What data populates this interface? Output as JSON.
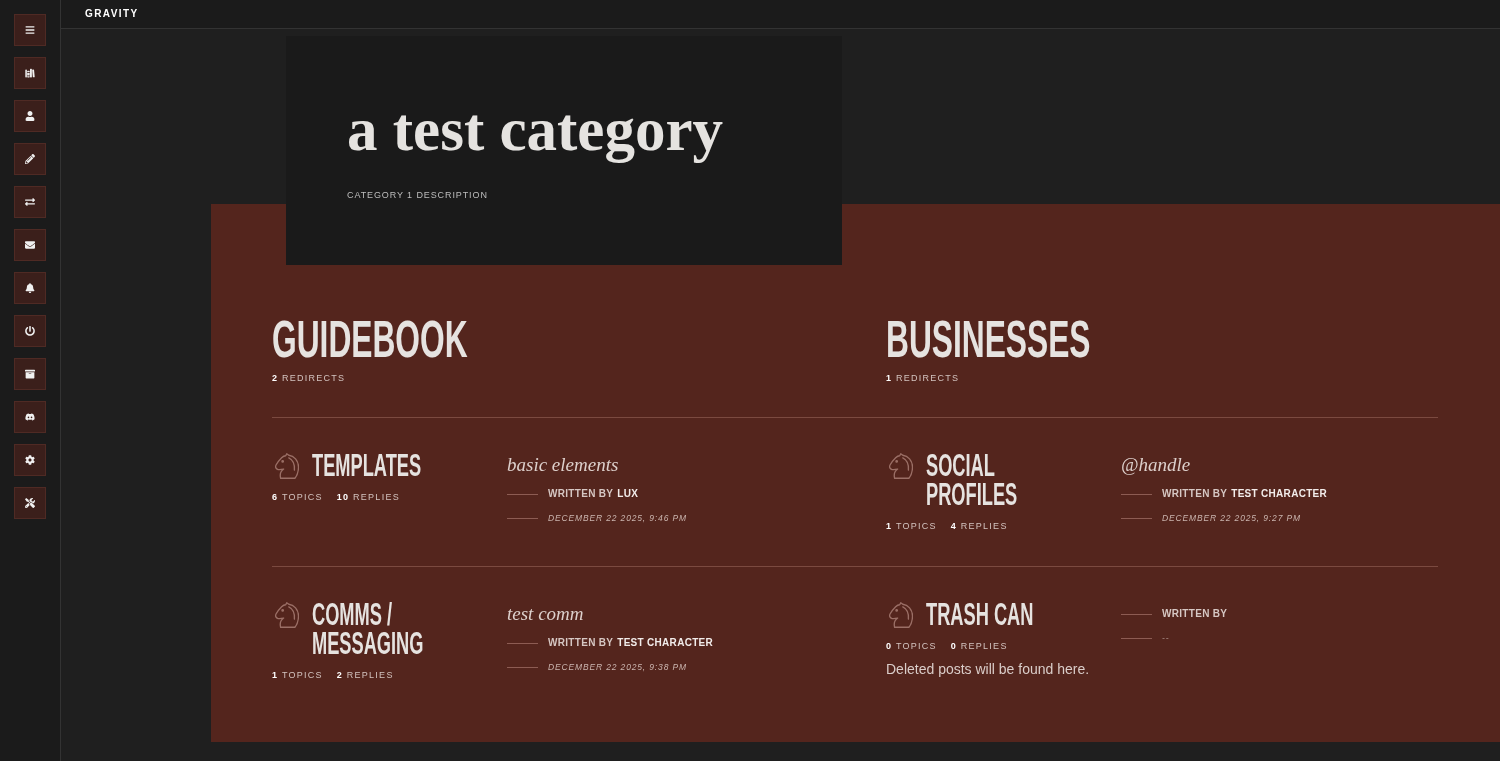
{
  "top_bar": {
    "site_title": "GRAVITY"
  },
  "category": {
    "title": "a test category",
    "description": "CATEGORY 1 DESCRIPTION"
  },
  "sections": [
    {
      "title": "GUIDEBOOK",
      "redirects": {
        "count": "2",
        "label": "REDIRECTS"
      },
      "forums": [
        {
          "title": "TEMPLATES",
          "topics": {
            "count": "6",
            "label": "TOPICS"
          },
          "replies": {
            "count": "10",
            "label": "REPLIES"
          },
          "last_post": {
            "title": "basic elements",
            "label": "WRITTEN BY",
            "author": "LUX",
            "date": "DECEMBER 22 2025, 9:46 PM"
          }
        },
        {
          "title": "COMMS / MESSAGING",
          "topics": {
            "count": "1",
            "label": "TOPICS"
          },
          "replies": {
            "count": "2",
            "label": "REPLIES"
          },
          "last_post": {
            "title": "test comm",
            "label": "WRITTEN BY",
            "author": "TEST CHARACTER",
            "date": "DECEMBER 22 2025, 9:38 PM"
          }
        }
      ]
    },
    {
      "title": "BUSINESSES",
      "redirects": {
        "count": "1",
        "label": "REDIRECTS"
      },
      "forums": [
        {
          "title": "SOCIAL PROFILES",
          "topics": {
            "count": "1",
            "label": "TOPICS"
          },
          "replies": {
            "count": "4",
            "label": "REPLIES"
          },
          "last_post": {
            "title": "@handle",
            "label": "WRITTEN BY",
            "author": "TEST CHARACTER",
            "date": "DECEMBER 22 2025, 9:27 PM"
          }
        },
        {
          "title": "TRASH CAN",
          "topics": {
            "count": "0",
            "label": "TOPICS"
          },
          "replies": {
            "count": "0",
            "label": "REPLIES"
          },
          "description": "Deleted posts will be found here.",
          "last_post": {
            "label": "WRITTEN BY",
            "date": "--"
          }
        }
      ]
    }
  ]
}
